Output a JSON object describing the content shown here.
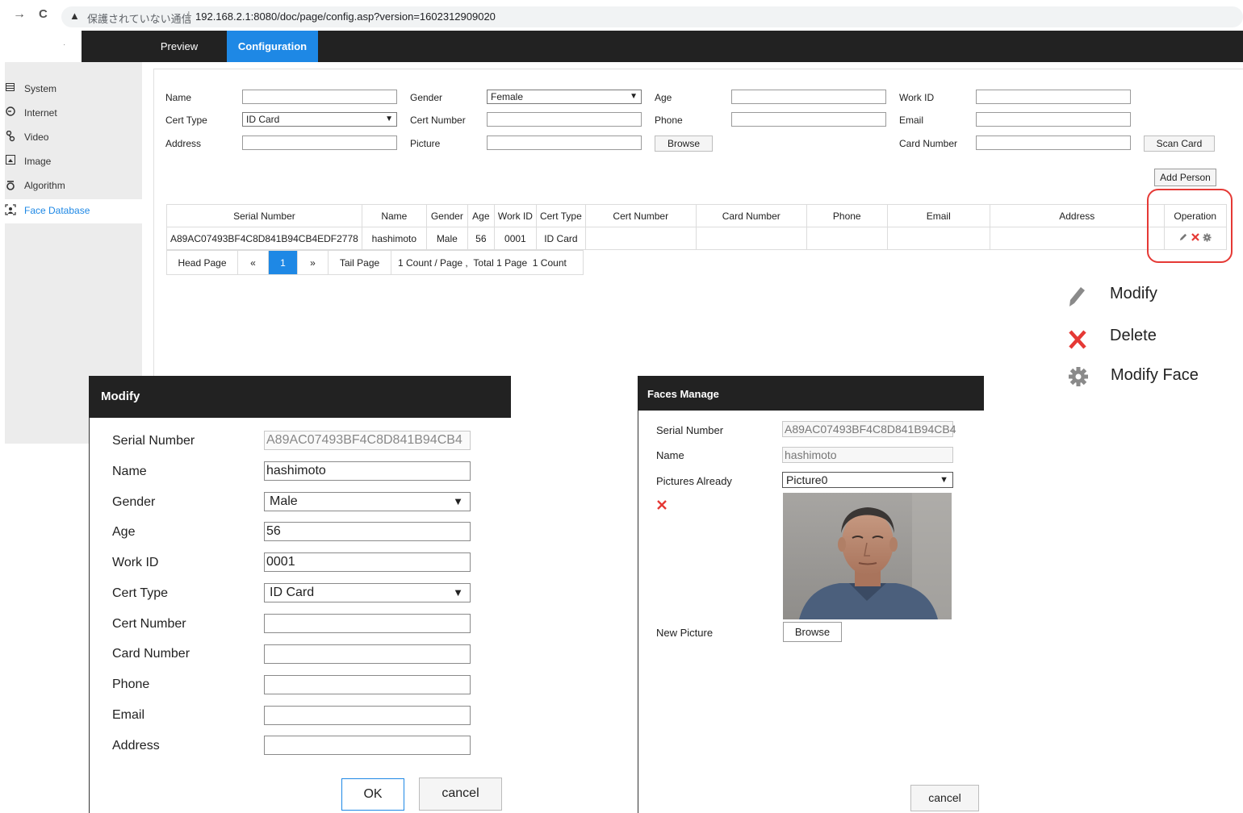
{
  "browser": {
    "back": "→",
    "reload": "C",
    "warning_icon": "▲",
    "security_text": "保護されていない通信",
    "url": "192.168.2.1:8080/doc/page/config.asp?version=1602312909020"
  },
  "header": {
    "logo": "·",
    "tabs": [
      {
        "label": "Preview"
      },
      {
        "label": "Configuration"
      }
    ]
  },
  "sidebar": {
    "items": [
      {
        "label": "System",
        "icon": "system-icon"
      },
      {
        "label": "Internet",
        "icon": "internet-icon"
      },
      {
        "label": "Video",
        "icon": "video-icon"
      },
      {
        "label": "Image",
        "icon": "image-icon"
      },
      {
        "label": "Algorithm",
        "icon": "algorithm-icon"
      },
      {
        "label": "Face Database",
        "icon": "face-database-icon"
      }
    ]
  },
  "form": {
    "name_label": "Name",
    "gender_label": "Gender",
    "gender_value": "Female",
    "age_label": "Age",
    "work_id_label": "Work ID",
    "cert_type_label": "Cert Type",
    "cert_type_value": "ID Card",
    "cert_number_label": "Cert Number",
    "phone_label": "Phone",
    "email_label": "Email",
    "address_label": "Address",
    "picture_label": "Picture",
    "browse_label": "Browse",
    "card_number_label": "Card Number",
    "scan_card_label": "Scan Card",
    "add_person_label": "Add Person"
  },
  "table": {
    "headers": [
      "Serial Number",
      "Name",
      "Gender",
      "Age",
      "Work ID",
      "Cert Type",
      "Cert Number",
      "Card Number",
      "Phone",
      "Email",
      "Address",
      "Operation"
    ],
    "rows": [
      [
        "A89AC07493BF4C8D841B94CB4EDF2778",
        "hashimoto",
        "Male",
        "56",
        "0001",
        "ID Card",
        "",
        "",
        "",
        "",
        ""
      ]
    ]
  },
  "pager": {
    "head": "Head Page",
    "prev": "«",
    "current": "1",
    "next": "»",
    "tail": "Tail Page",
    "info1": "1 Count / Page ,",
    "info2": "Total 1 Page",
    "info3": "1 Count"
  },
  "legend": {
    "modify": "Modify",
    "delete": "Delete",
    "modify_face": "Modify Face"
  },
  "modify_dialog": {
    "title": "Modify",
    "fields": [
      {
        "label": "Serial Number",
        "value": "A89AC07493BF4C8D841B94CB4"
      },
      {
        "label": "Name",
        "value": "hashimoto"
      },
      {
        "label": "Gender",
        "value": "Male"
      },
      {
        "label": "Age",
        "value": "56"
      },
      {
        "label": "Work ID",
        "value": "0001"
      },
      {
        "label": "Cert Type",
        "value": "ID Card"
      },
      {
        "label": "Cert Number",
        "value": ""
      },
      {
        "label": "Card Number",
        "value": ""
      },
      {
        "label": "Phone",
        "value": ""
      },
      {
        "label": "Email",
        "value": ""
      },
      {
        "label": "Address",
        "value": ""
      }
    ],
    "ok": "OK",
    "cancel": "cancel"
  },
  "faces_dialog": {
    "title": "Faces Manage",
    "serial_label": "Serial Number",
    "serial_value": "A89AC07493BF4C8D841B94CB4",
    "name_label": "Name",
    "name_value": "hashimoto",
    "pictures_label": "Pictures Already",
    "pictures_value": "Picture0",
    "new_picture_label": "New Picture",
    "browse": "Browse",
    "cancel": "cancel"
  },
  "colors": {
    "accent": "#1e88e5",
    "header_bg": "#222222",
    "delete_red": "#e53935"
  }
}
